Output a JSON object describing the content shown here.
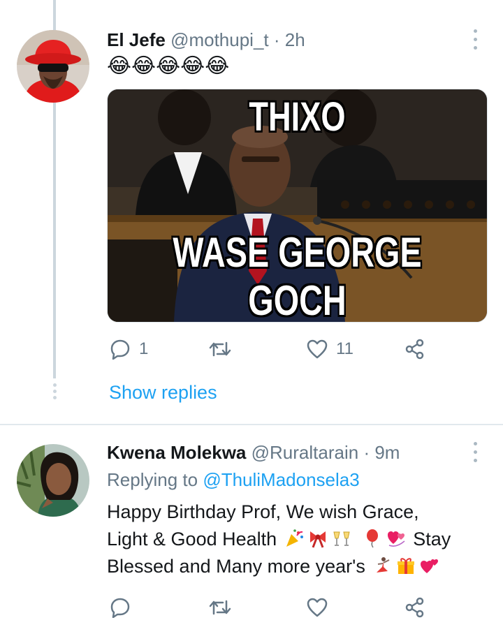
{
  "tweets": [
    {
      "name": "El Jefe",
      "handle": "@mothupi_t",
      "separator": "·",
      "time": "2h",
      "text_emoji": "😂😂😂😂😂",
      "media": {
        "top_text": "THIXO",
        "bottom_text": "WASE GEORGE GOCH"
      },
      "actions": {
        "reply_count": "1",
        "retweet_count": "",
        "like_count": "11"
      },
      "show_replies": "Show replies"
    },
    {
      "name": "Kwena Molekwa",
      "handle": "@Ruraltarain",
      "separator": "·",
      "time": "9m",
      "replying_prefix": "Replying to",
      "replying_mention": "@ThuliMadonsela3",
      "text_line1": "Happy Birthday Prof, We wish Grace,",
      "text_line2": "Light & Good Health",
      "text_line2_end": "Stay",
      "text_line3": "Blessed and Many more year's",
      "emojis": [
        "party-popper",
        "ribbon",
        "champagne-glasses",
        "balloon",
        "revolving-hearts",
        "dancer",
        "gift",
        "two-hearts"
      ]
    }
  ],
  "colors": {
    "accent": "#1da1f2",
    "muted": "#657786",
    "thread_line": "#ccd6dd"
  }
}
